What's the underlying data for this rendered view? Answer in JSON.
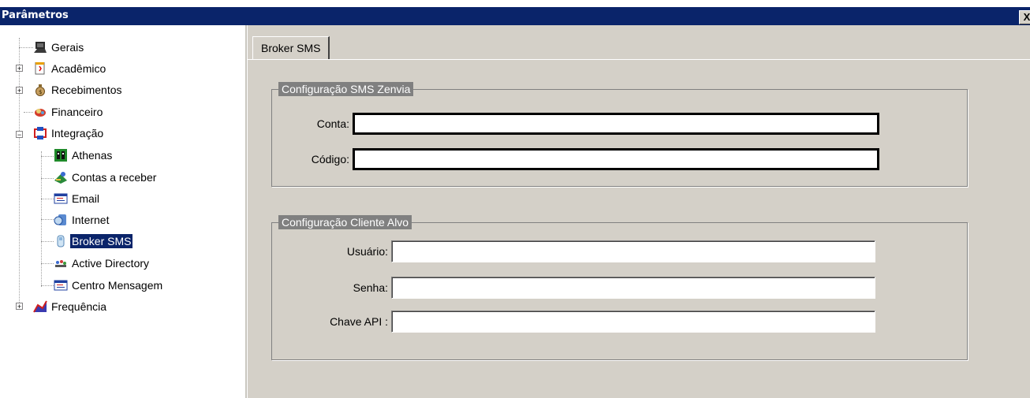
{
  "window": {
    "title": "Parâmetros",
    "close_glyph": "X"
  },
  "tree": {
    "items": [
      {
        "label": "Gerais",
        "icon": "computer-icon"
      },
      {
        "label": "Acadêmico",
        "icon": "document-icon"
      },
      {
        "label": "Recebimentos",
        "icon": "money-bag-icon"
      },
      {
        "label": "Financeiro",
        "icon": "finance-icon"
      },
      {
        "label": "Integração",
        "icon": "integration-icon"
      },
      {
        "label": "Athenas",
        "icon": "athenas-icon"
      },
      {
        "label": "Contas a receber",
        "icon": "receivables-icon"
      },
      {
        "label": "Email",
        "icon": "email-icon"
      },
      {
        "label": "Internet",
        "icon": "internet-icon"
      },
      {
        "label": "Broker SMS",
        "icon": "phone-icon",
        "selected": true
      },
      {
        "label": "Active Directory",
        "icon": "users-icon"
      },
      {
        "label": "Centro Mensagem",
        "icon": "message-icon"
      },
      {
        "label": "Frequência",
        "icon": "frequency-icon"
      }
    ]
  },
  "tabs": {
    "active": "Broker SMS"
  },
  "zenvia": {
    "legend": "Configuração SMS Zenvia",
    "conta_label": "Conta:",
    "conta_value": "",
    "codigo_label": "Código:",
    "codigo_value": ""
  },
  "cliente": {
    "legend": "Configuração Cliente Alvo",
    "usuario_label": "Usuário:",
    "usuario_value": "",
    "senha_label": "Senha:",
    "senha_value": "",
    "chave_label": "Chave API :",
    "chave_value": ""
  },
  "colors": {
    "titlebar": "#0a246a",
    "panel": "#d4d0c8",
    "selection": "#0a246a",
    "legend_bg": "#808080"
  }
}
